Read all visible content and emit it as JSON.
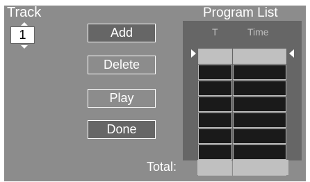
{
  "track": {
    "label": "Track",
    "value": "1"
  },
  "buttons": {
    "add": "Add",
    "delete": "Delete",
    "play": "Play",
    "done": "Done"
  },
  "program_list": {
    "title": "Program List",
    "columns": [
      "T",
      "Time"
    ],
    "row_count": 8,
    "selected_row": 1,
    "rows": [
      {
        "t": "",
        "time": ""
      },
      {
        "t": "",
        "time": ""
      },
      {
        "t": "",
        "time": ""
      },
      {
        "t": "",
        "time": ""
      },
      {
        "t": "",
        "time": ""
      },
      {
        "t": "",
        "time": ""
      },
      {
        "t": "",
        "time": ""
      },
      {
        "t": "",
        "time": ""
      }
    ]
  },
  "total": {
    "label": "Total:",
    "t": "",
    "time": ""
  },
  "icons": {
    "track_up": "triangle-up-icon",
    "track_down": "triangle-down-icon",
    "row_pointer_left": "triangle-right-icon",
    "row_pointer_right": "triangle-left-icon"
  },
  "colors": {
    "panel": "#8c8c8c",
    "table_bg": "#666666",
    "cell_empty": "#1a1a1a",
    "cell_selected": "#c0c0c0",
    "text": "#ffffff"
  }
}
